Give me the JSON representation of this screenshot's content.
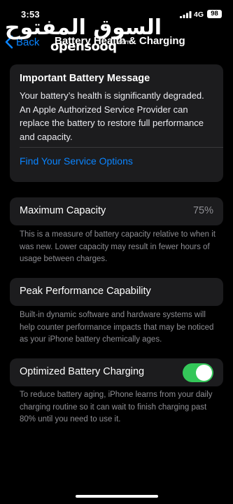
{
  "status_bar": {
    "time": "3:53",
    "network": "4G",
    "battery_level": "98"
  },
  "nav": {
    "back_label": "Back",
    "title": "Battery Health & Charging"
  },
  "watermark": {
    "arabic": "السوق المفتوح",
    "latin": "opensooq",
    "suffix": ".com"
  },
  "battery_message": {
    "title": "Important Battery Message",
    "body": "Your battery’s health is significantly degraded. An Apple Authorized Service Provider can replace the battery to restore full performance and capacity.",
    "link": "Find Your Service Options"
  },
  "maximum_capacity": {
    "label": "Maximum Capacity",
    "value": "75%",
    "footer": "This is a measure of battery capacity relative to when it was new. Lower capacity may result in fewer hours of usage between charges."
  },
  "peak_performance": {
    "label": "Peak Performance Capability",
    "footer": "Built-in dynamic software and hardware systems will help counter performance impacts that may be noticed as your iPhone battery chemically ages."
  },
  "optimized_charging": {
    "label": "Optimized Battery Charging",
    "enabled": true,
    "footer": "To reduce battery aging, iPhone learns from your daily charging routine so it can wait to finish charging past 80% until you need to use it."
  },
  "colors": {
    "accent": "#0a84ff",
    "toggle_on": "#34c759",
    "card_bg": "#1c1c1e",
    "secondary_text": "#8e8e93"
  },
  "icons": {
    "back": "chevron-left-icon",
    "signal": "cellular-signal-icon"
  }
}
